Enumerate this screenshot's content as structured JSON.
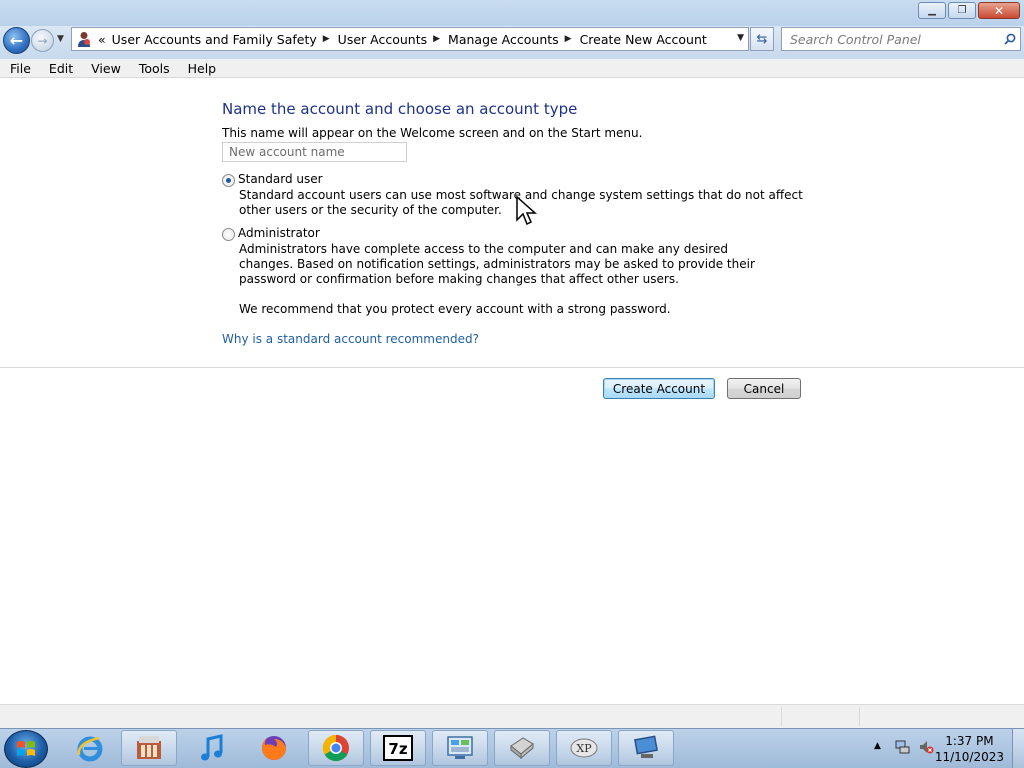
{
  "window": {
    "minimize_glyph": "▁",
    "maximize_glyph": "❐",
    "close_glyph": "✕"
  },
  "nav": {
    "back_glyph": "←",
    "forward_glyph": "→",
    "chevron": "«",
    "breadcrumbs": [
      "User Accounts and Family Safety",
      "User Accounts",
      "Manage Accounts",
      "Create New Account"
    ],
    "search_placeholder": "Search Control Panel"
  },
  "menu": [
    "File",
    "Edit",
    "View",
    "Tools",
    "Help"
  ],
  "page": {
    "heading": "Name the account and choose an account type",
    "subtext": "This name will appear on the Welcome screen and on the Start menu.",
    "name_placeholder": "New account name",
    "options": [
      {
        "label": "Standard user",
        "checked": true,
        "description": "Standard account users can use most software and change system settings that do not affect other users or the security of the computer."
      },
      {
        "label": "Administrator",
        "checked": false,
        "description": "Administrators have complete access to the computer and can make any desired changes. Based on notification settings, administrators may be asked to provide their password or confirmation before making changes that affect other users."
      }
    ],
    "recommendation": "We recommend that you protect every account with a strong password.",
    "help_link": "Why is a standard account recommended?",
    "create_button": "Create Account",
    "cancel_button": "Cancel"
  },
  "taskbar": {
    "apps": [
      "internet-explorer",
      "control-panel-store",
      "itunes",
      "firefox",
      "chrome",
      "7zip",
      "control-panel",
      "printer-tool",
      "xp-mode",
      "remote-desktop"
    ],
    "time": "1:37 PM",
    "date": "11/10/2023"
  }
}
